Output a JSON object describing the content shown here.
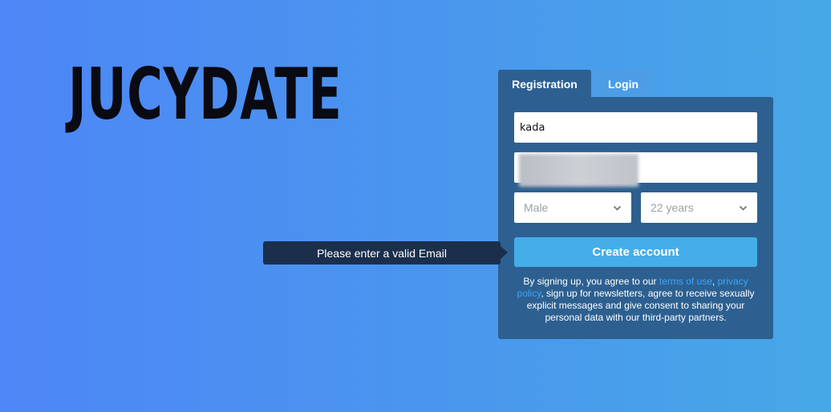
{
  "brand": {
    "logo_text": "JUCYDATE"
  },
  "tabs": [
    {
      "label": "Registration",
      "active": true
    },
    {
      "label": "Login",
      "active": false
    }
  ],
  "form": {
    "name_value": "kada",
    "email_value": "",
    "gender": {
      "selected": "Male"
    },
    "age": {
      "selected": "22 years"
    },
    "submit_label": "Create account"
  },
  "tooltip": {
    "text": "Please enter a valid Email"
  },
  "terms": {
    "prefix": "By signing up, you agree to our ",
    "terms_link": "terms of use",
    "separator": ", ",
    "privacy_link": "privacy policy",
    "suffix": ", sign up for newsletters, agree to receive sexually explicit messages and give consent to sharing your personal data with our third-party partners."
  },
  "colors": {
    "panel": "#2d6090",
    "button": "#45ade8",
    "link": "#3ba5ff",
    "tooltip": "#1b2f4c"
  },
  "icons": {
    "select_arrow": "chevron-down-icon"
  }
}
